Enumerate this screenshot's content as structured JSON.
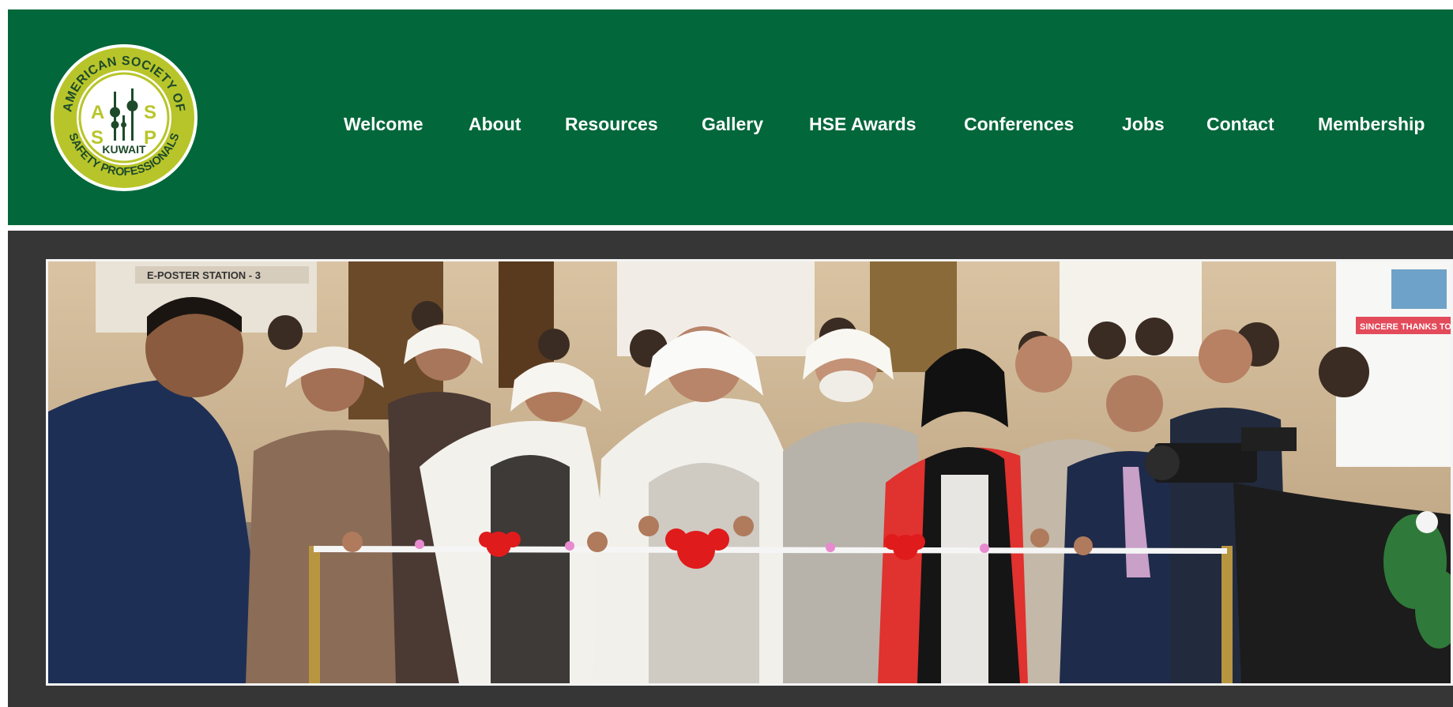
{
  "header": {
    "brand_color": "#02673a",
    "logo": {
      "ring_text_top": "AMERICAN SOCIETY OF",
      "ring_text_bottom": "SAFETY PROFESSIONALS",
      "letters": [
        "A",
        "S",
        "S",
        "P"
      ],
      "center_text": "KUWAIT"
    },
    "nav": [
      {
        "label": "Welcome"
      },
      {
        "label": "About"
      },
      {
        "label": "Resources"
      },
      {
        "label": "Gallery"
      },
      {
        "label": "HSE Awards"
      },
      {
        "label": "Conferences"
      },
      {
        "label": "Jobs"
      },
      {
        "label": "Contact"
      },
      {
        "label": "Membership"
      }
    ]
  },
  "banner": {
    "background_color": "#363636",
    "hero_image": {
      "description": "Ribbon cutting ceremony at conference exhibition",
      "sign_text": "E-POSTER STATION - 3",
      "banner_text": "SINCERE THANKS TO PL"
    }
  }
}
